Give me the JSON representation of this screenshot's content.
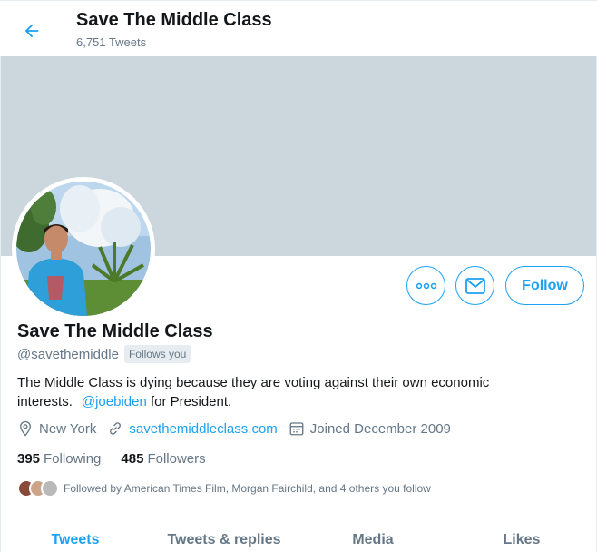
{
  "header": {
    "title": "Save The Middle Class",
    "tweet_count": "6,751 Tweets"
  },
  "profile": {
    "name": "Save The Middle Class",
    "handle": "@savethemiddle",
    "follows_you": "Follows you",
    "bio_text": "The Middle Class is dying because they are voting against their own economic interests.",
    "bio_mention": "@joebiden",
    "bio_suffix": " for President.",
    "location": "New York",
    "website": "savethemiddleclass.com",
    "joined": "Joined December 2009"
  },
  "actions": {
    "follow_label": "Follow"
  },
  "stats": {
    "following_count": "395",
    "following_label": "Following",
    "followers_count": "485",
    "followers_label": "Followers"
  },
  "followed_by": "Followed by American Times Film, Morgan Fairchild, and 4 others you follow",
  "tabs": [
    {
      "label": "Tweets"
    },
    {
      "label": "Tweets & replies"
    },
    {
      "label": "Media"
    },
    {
      "label": "Likes"
    }
  ],
  "colors": {
    "accent": "#1da1f2",
    "banner": "#ccd6dd",
    "muted": "#657786"
  }
}
